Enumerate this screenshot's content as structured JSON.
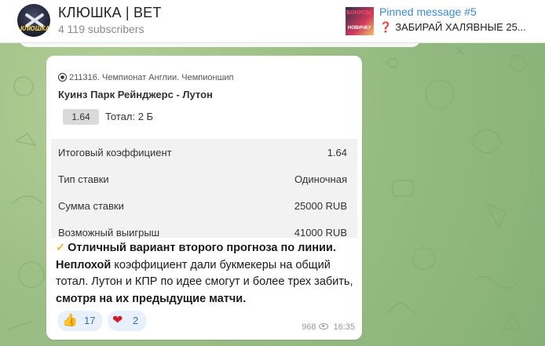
{
  "channel": {
    "title": "КЛЮШКА | BET",
    "subscribers": "4 119 subscribers",
    "avatar_text": "КЛЮШКА"
  },
  "pinned": {
    "title": "Pinned message #5",
    "text": "ЗАБИРАЙ ХАЛЯВНЫЕ 25...",
    "icon": "❓",
    "thumb_text_top": "БОНУСЫ",
    "thumb_text_bottom": "НОВИЧКУ"
  },
  "bet": {
    "meta": "211316. Чемпионат Англии. Чемпионшип",
    "match": "Куинз Парк Рейнджерс - Лутон",
    "odds": "1.64",
    "market": "Тотал: 2 Б",
    "summary": [
      {
        "key": "Итоговый коэффициент",
        "value": "1.64"
      },
      {
        "key": "Тип ставки",
        "value": "Одиночная"
      },
      {
        "key": "Сумма ставки",
        "value": "25000 RUB"
      },
      {
        "key": "Возможный выигрыш",
        "value": "41000 RUB"
      }
    ]
  },
  "message": {
    "check": "✓",
    "part1_bold": "Отличный вариант второго прогноза по линии.",
    "part2_bold": "Неплохой",
    "part3": " коэффициент дали букмекеры на общий тотал. Лутон и КПР по идее смогут и более трех забить, ",
    "part4_bold": "смотря на их предыдущие матчи."
  },
  "reactions": [
    {
      "emoji": "👍",
      "count": "17"
    },
    {
      "emoji": "❤",
      "count": "2"
    }
  ],
  "footer": {
    "views": "968",
    "time": "16:35"
  },
  "colors": {
    "link": "#3a8ad6",
    "reaction_bg": "#e7f0fb",
    "chat_bg": "#9cc08a"
  }
}
